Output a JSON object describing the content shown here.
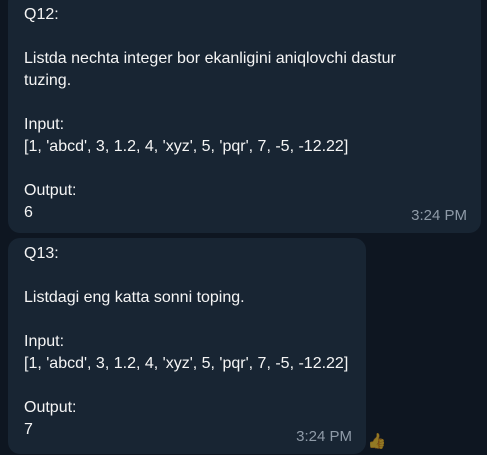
{
  "messages": [
    {
      "title": "Q12:",
      "text": [
        "Listda nechta integer bor ekanligini aniqlovchi dastur",
        "tuzing."
      ],
      "input_label": "Input:",
      "input_value": "[1, 'abcd', 3, 1.2, 4, 'xyz', 5, 'pqr', 7, -5, -12.22]",
      "output_label": "Output:",
      "output_value": "6",
      "time": "3:24 PM"
    },
    {
      "title": "Q13:",
      "text": [
        "Listdagi eng katta sonni toping."
      ],
      "input_label": "Input:",
      "input_value": "[1, 'abcd', 3, 1.2, 4, 'xyz', 5, 'pqr', 7, -5, -12.22]",
      "output_label": "Output:",
      "output_value": "7",
      "time": "3:24 PM"
    }
  ],
  "side_icon": "thumbs-up-icon",
  "colors": {
    "background": "#0e1621",
    "bubble": "#182533",
    "text": "#f5f5f5",
    "time": "#8f9ba8"
  }
}
